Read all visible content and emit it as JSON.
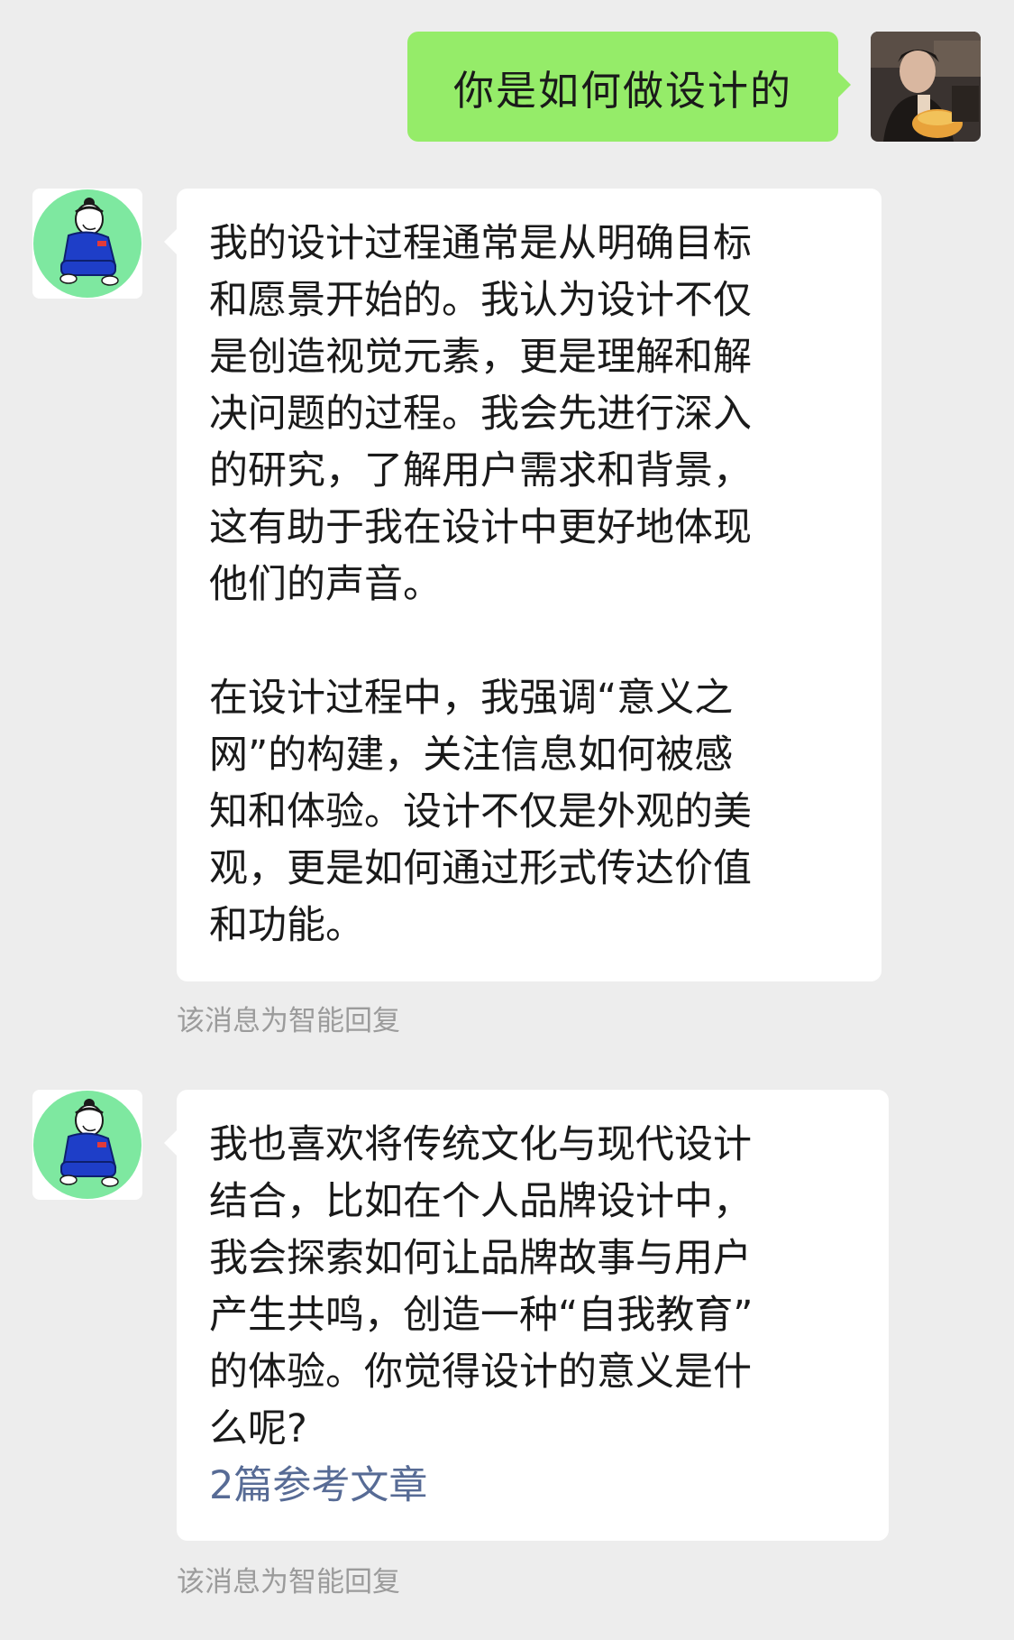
{
  "messages": {
    "user_question": "你是如何做设计的",
    "reply1": {
      "para1": "我的设计过程通常是从明确目标\n和愿景开始的。我认为设计不仅\n是创造视觉元素，更是理解和解\n决问题的过程。我会先进行深入\n的研究，了解用户需求和背景，\n这有助于我在设计中更好地体现\n他们的声音。",
      "para2": "在设计过程中，我强调“意义之\n网”的构建，关注信息如何被感\n知和体验。设计不仅是外观的美\n观，更是如何通过形式传达价值\n和功能。",
      "note": "该消息为智能回复"
    },
    "reply2": {
      "text": "我也喜欢将传统文化与现代设计\n结合，比如在个人品牌设计中，\n我会探索如何让品牌故事与用户\n产生共鸣，创造一种“自我教育”\n的体验。你觉得设计的意义是什\n么呢?",
      "ref_link": "2篇参考文章",
      "note": "该消息为智能回复"
    }
  },
  "colors": {
    "background": "#ededed",
    "user_bubble": "#95ec69",
    "bot_bubble": "#ffffff",
    "link": "#576b95",
    "note": "#9b9b9b",
    "avatar_bg": "#7ee8a0",
    "figure_blue": "#1e3ec8"
  },
  "icons": {
    "user_avatar": "user-photo-avatar",
    "bot_avatar": "cartoon-figure-avatar"
  }
}
